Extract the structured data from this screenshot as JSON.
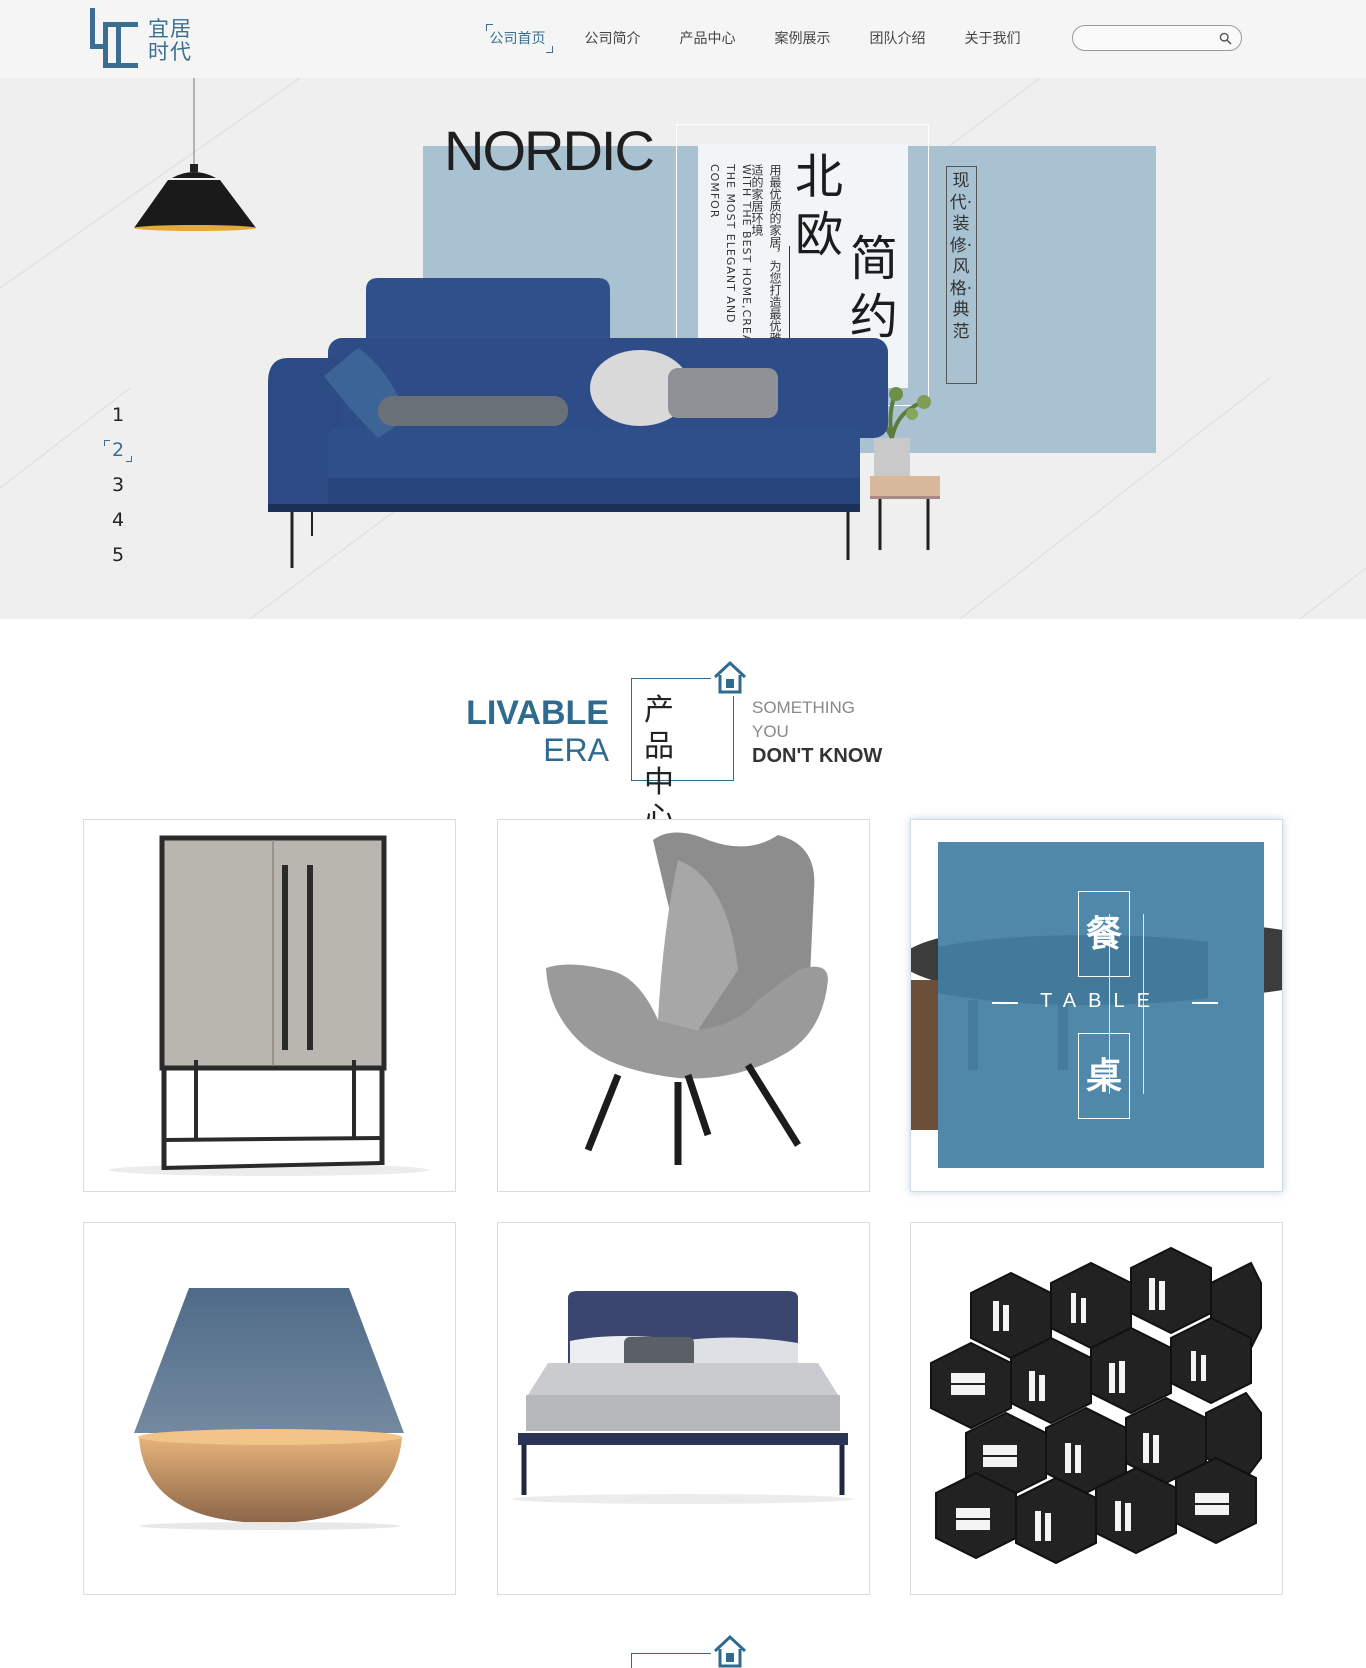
{
  "brand": {
    "logo_text": "宜居\n时代",
    "accent_color": "#3a6f92"
  },
  "nav": {
    "items": [
      {
        "label": "公司首页",
        "active": true
      },
      {
        "label": "公司简介",
        "active": false
      },
      {
        "label": "产品中心",
        "active": false
      },
      {
        "label": "案例展示",
        "active": false
      },
      {
        "label": "团队介绍",
        "active": false
      },
      {
        "label": "关于我们",
        "active": false
      }
    ],
    "search_placeholder": "",
    "search_icon": "search-icon"
  },
  "hero": {
    "headline_en": "NORDIC",
    "title_cn_1": "北欧",
    "title_cn_2": "简约",
    "slogan_cn": "用最优质的家居，为您打造最优雅最舒适的家居环境",
    "slogan_en": "WITH THE BEST HOME,CREATE THE MOST ELEGANT AND COMFOR",
    "tag": "现代·装修·风格·典范",
    "slides": [
      "1",
      "2",
      "3",
      "4",
      "5"
    ],
    "active_slide": "2"
  },
  "products_section": {
    "left_bold": "LIVABLE",
    "left_light": "ERA",
    "title_cn": "产品中心",
    "right_light_1": "SOMETHING",
    "right_light_2": "YOU",
    "right_bold": "DON'T KNOW",
    "house_icon": "house-icon"
  },
  "products": [
    {
      "name": "cabinet"
    },
    {
      "name": "wing-chair"
    },
    {
      "name": "dining-table",
      "overlay_cn_top": "餐",
      "overlay_en": "TABLE",
      "overlay_cn_bottom": "桌"
    },
    {
      "name": "table-lamp"
    },
    {
      "name": "bed"
    },
    {
      "name": "honeycomb-bookshelf"
    }
  ]
}
